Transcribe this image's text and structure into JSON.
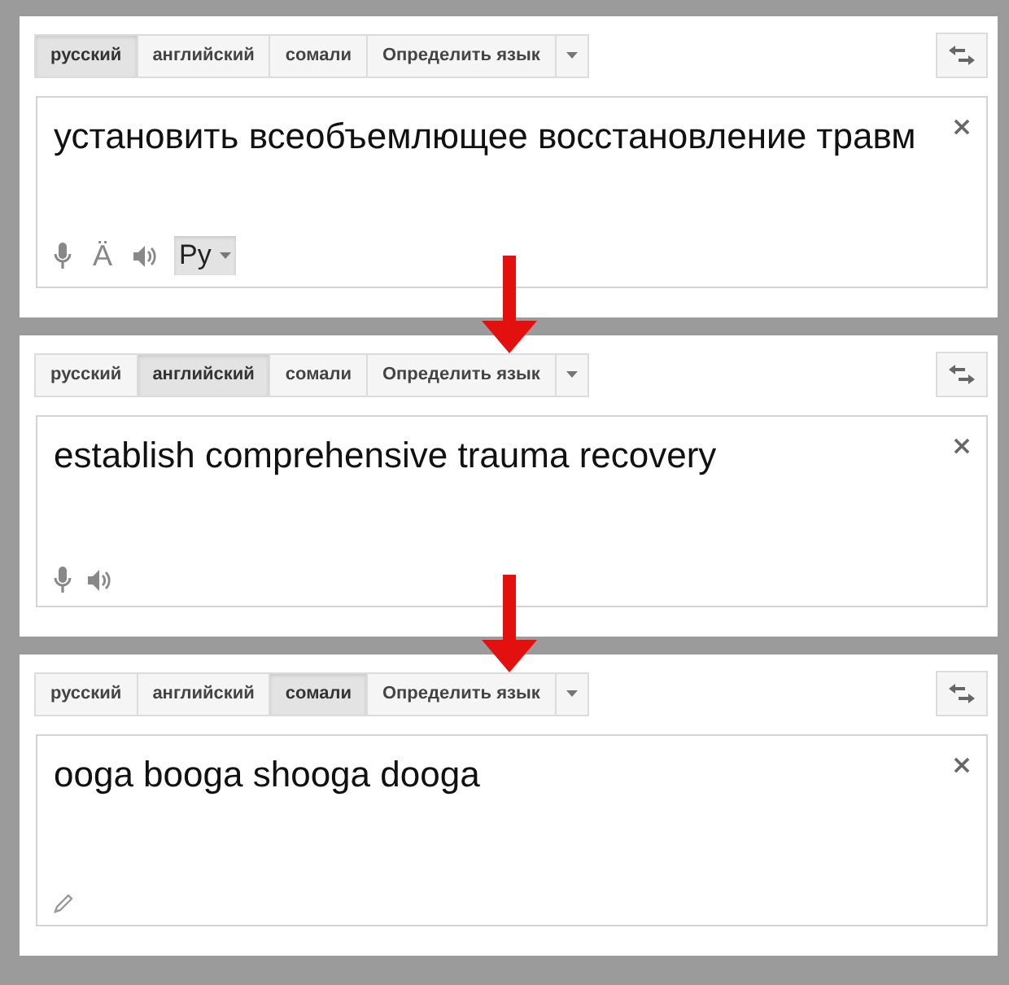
{
  "panels": [
    {
      "tabs": [
        {
          "label": "русский",
          "selected": true
        },
        {
          "label": "английский",
          "selected": false
        },
        {
          "label": "сомали",
          "selected": false
        },
        {
          "label": "Определить язык",
          "selected": false
        }
      ],
      "text": "установить всеобъемлющее восстановление травм",
      "tools": [
        {
          "kind": "mic",
          "selected": false
        },
        {
          "kind": "glyph",
          "label": "Ä",
          "selected": false
        },
        {
          "kind": "speaker",
          "selected": false
        },
        {
          "kind": "input",
          "label": "Ру",
          "selected": true
        }
      ]
    },
    {
      "tabs": [
        {
          "label": "русский",
          "selected": false
        },
        {
          "label": "английский",
          "selected": true
        },
        {
          "label": "сомали",
          "selected": false
        },
        {
          "label": "Определить язык",
          "selected": false
        }
      ],
      "text": "establish comprehensive trauma recovery",
      "tools": [
        {
          "kind": "mic",
          "selected": false
        },
        {
          "kind": "speaker",
          "selected": false
        }
      ]
    },
    {
      "tabs": [
        {
          "label": "русский",
          "selected": false
        },
        {
          "label": "английский",
          "selected": false
        },
        {
          "label": "сомали",
          "selected": true
        },
        {
          "label": "Определить язык",
          "selected": false
        }
      ],
      "text": "ooga booga shooga dooga",
      "tools": [
        {
          "kind": "pencil",
          "selected": false
        }
      ]
    }
  ]
}
